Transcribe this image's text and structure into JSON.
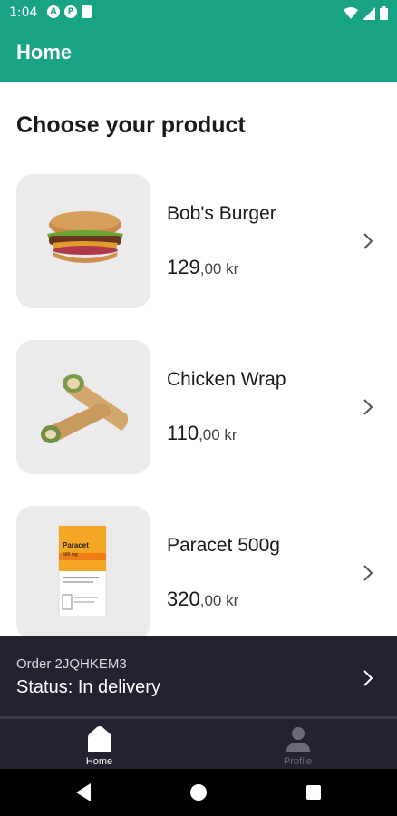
{
  "status_bar": {
    "time": "1:04",
    "notification_icons": [
      "A",
      "P"
    ],
    "right_icons": [
      "wifi-icon",
      "signal-icon",
      "battery-icon"
    ]
  },
  "app_bar": {
    "title": "Home"
  },
  "section_heading": "Choose your product",
  "products": [
    {
      "name": "Bob's Burger",
      "price_int": "129",
      "price_rest": ",00 kr",
      "image": "burger-image"
    },
    {
      "name": "Chicken Wrap",
      "price_int": "110",
      "price_rest": ",00 kr",
      "image": "wrap-image"
    },
    {
      "name": "Paracet 500g",
      "price_int": "320",
      "price_rest": ",00 kr",
      "image": "paracet-box-image",
      "packaging": {
        "brand": "Paracet",
        "strength": "500 mg"
      }
    }
  ],
  "order_bar": {
    "order_id": "Order 2JQHKEM3",
    "status": "Status: In delivery"
  },
  "bottom_nav": {
    "items": [
      {
        "label": "Home",
        "icon": "home-icon",
        "active": true
      },
      {
        "label": "Profile",
        "icon": "profile-icon",
        "active": false
      }
    ]
  },
  "colors": {
    "primary": "#17a384",
    "dark_bar": "#222230",
    "thumb_bg": "#ebebeb",
    "nav_active": "#ffffff",
    "nav_inactive": "#6b6b78"
  }
}
